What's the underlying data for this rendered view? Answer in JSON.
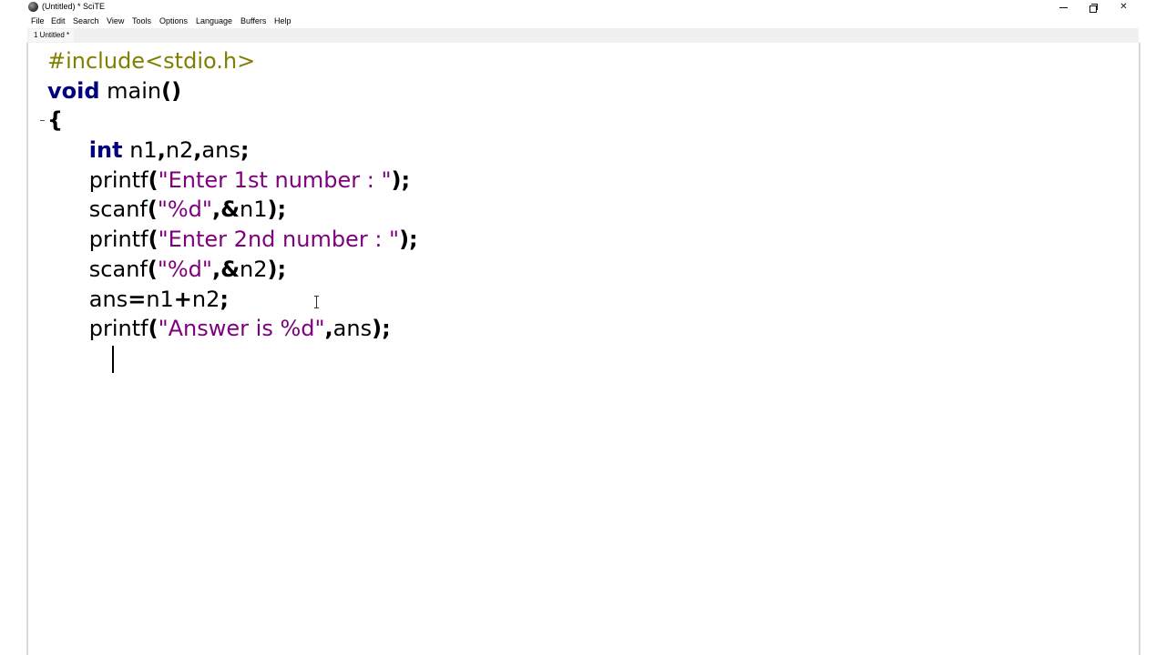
{
  "window": {
    "title": "(Untitled) * SciTE"
  },
  "menu": {
    "items": [
      "File",
      "Edit",
      "Search",
      "View",
      "Tools",
      "Options",
      "Language",
      "Buffers",
      "Help"
    ]
  },
  "tabs": [
    {
      "label": "1 Untitled *",
      "active": true
    }
  ],
  "editor": {
    "lines": [
      [
        {
          "t": "#include<stdio.h>",
          "c": "pp"
        }
      ],
      [
        {
          "t": "void",
          "c": "kw"
        },
        {
          "t": " main",
          "c": "id"
        },
        {
          "t": "()",
          "c": "op"
        }
      ],
      [
        {
          "t": "{",
          "c": "op"
        }
      ],
      [
        {
          "t": "      ",
          "c": "id"
        },
        {
          "t": "int",
          "c": "kw"
        },
        {
          "t": " n1",
          "c": "id"
        },
        {
          "t": ",",
          "c": "op"
        },
        {
          "t": "n2",
          "c": "id"
        },
        {
          "t": ",",
          "c": "op"
        },
        {
          "t": "ans",
          "c": "id"
        },
        {
          "t": ";",
          "c": "op"
        }
      ],
      [
        {
          "t": "      ",
          "c": "id"
        },
        {
          "t": "printf",
          "c": "id"
        },
        {
          "t": "(",
          "c": "op"
        },
        {
          "t": "\"Enter 1st number : \"",
          "c": "str"
        },
        {
          "t": ");",
          "c": "op"
        }
      ],
      [
        {
          "t": "      ",
          "c": "id"
        },
        {
          "t": "scanf",
          "c": "id"
        },
        {
          "t": "(",
          "c": "op"
        },
        {
          "t": "\"%d\"",
          "c": "str"
        },
        {
          "t": ",&",
          "c": "op"
        },
        {
          "t": "n1",
          "c": "id"
        },
        {
          "t": ");",
          "c": "op"
        }
      ],
      [
        {
          "t": "      ",
          "c": "id"
        },
        {
          "t": "printf",
          "c": "id"
        },
        {
          "t": "(",
          "c": "op"
        },
        {
          "t": "\"Enter 2nd number : \"",
          "c": "str"
        },
        {
          "t": ");",
          "c": "op"
        }
      ],
      [
        {
          "t": "      ",
          "c": "id"
        },
        {
          "t": "scanf",
          "c": "id"
        },
        {
          "t": "(",
          "c": "op"
        },
        {
          "t": "\"%d\"",
          "c": "str"
        },
        {
          "t": ",&",
          "c": "op"
        },
        {
          "t": "n2",
          "c": "id"
        },
        {
          "t": ");",
          "c": "op"
        }
      ],
      [
        {
          "t": "      ",
          "c": "id"
        },
        {
          "t": "ans",
          "c": "id"
        },
        {
          "t": "=",
          "c": "op"
        },
        {
          "t": "n1",
          "c": "id"
        },
        {
          "t": "+",
          "c": "op"
        },
        {
          "t": "n2",
          "c": "id"
        },
        {
          "t": ";",
          "c": "op"
        }
      ],
      [
        {
          "t": "      ",
          "c": "id"
        },
        {
          "t": "printf",
          "c": "id"
        },
        {
          "t": "(",
          "c": "op"
        },
        {
          "t": "\"Answer is %d\"",
          "c": "str"
        },
        {
          "t": ",",
          "c": "op"
        },
        {
          "t": "ans",
          "c": "id"
        },
        {
          "t": ");",
          "c": "op"
        }
      ],
      [
        {
          "t": "      ",
          "c": "id"
        }
      ]
    ]
  },
  "colors": {
    "preprocessor": "#7f7f00",
    "keyword": "#00007f",
    "string": "#7f007f",
    "operator": "#000000"
  },
  "icons": {
    "app": "scite-app-icon",
    "minimize": "minimize-icon",
    "maximize": "restore-icon",
    "close": "close-icon",
    "fold": "fold-marker-icon",
    "cursor": "ibeam-cursor-icon"
  }
}
